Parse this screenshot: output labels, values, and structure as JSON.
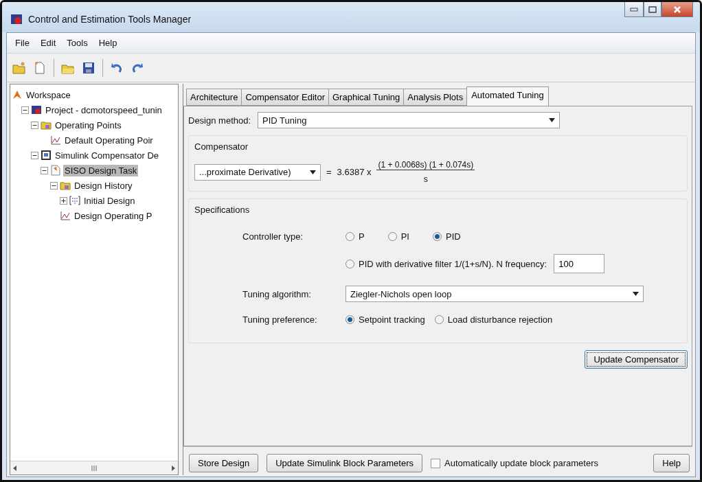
{
  "window": {
    "title": "Control and Estimation Tools Manager"
  },
  "menu": [
    "File",
    "Edit",
    "Tools",
    "Help"
  ],
  "tree": [
    {
      "label": "Workspace",
      "kind": "workspace",
      "selected": false,
      "children": [
        {
          "label": "Project - dcmotorspeed_tunin",
          "kind": "project",
          "expanded": true,
          "selected": false,
          "children": [
            {
              "label": "Operating Points",
              "kind": "folder",
              "expanded": true,
              "selected": false,
              "children": [
                {
                  "label": "Default Operating Poir",
                  "kind": "plot",
                  "selected": false
                }
              ]
            },
            {
              "label": "Simulink Compensator De",
              "kind": "model",
              "expanded": true,
              "selected": false,
              "children": [
                {
                  "label": "SISO Design Task",
                  "kind": "task",
                  "expanded": true,
                  "selected": true,
                  "children": [
                    {
                      "label": "Design History",
                      "kind": "folder",
                      "expanded": true,
                      "selected": false,
                      "children": [
                        {
                          "label": "Initial Design",
                          "kind": "design",
                          "expanded": false,
                          "selected": false
                        }
                      ]
                    },
                    {
                      "label": "Design Operating P",
                      "kind": "plot",
                      "selected": false
                    }
                  ]
                }
              ]
            }
          ]
        }
      ]
    }
  ],
  "tabs": [
    {
      "label": "Architecture",
      "selected": false
    },
    {
      "label": "Compensator Editor",
      "selected": false
    },
    {
      "label": "Graphical Tuning",
      "selected": false
    },
    {
      "label": "Analysis Plots",
      "selected": false
    },
    {
      "label": "Automated Tuning",
      "selected": true
    }
  ],
  "design_method": {
    "label": "Design method:",
    "value": "PID Tuning"
  },
  "compensator": {
    "title": "Compensator",
    "form": "...proximate Derivative)",
    "equals": "=",
    "gain": "3.6387 x",
    "numerator": "(1 + 0.0068s) (1 + 0.074s)",
    "denominator": "s"
  },
  "specifications": {
    "title": "Specifications",
    "controller_type": {
      "label": "Controller type:",
      "options": [
        {
          "label": "P",
          "selected": false
        },
        {
          "label": "PI",
          "selected": false
        },
        {
          "label": "PID",
          "selected": true
        }
      ]
    },
    "filter_option": {
      "label": "PID with derivative filter 1/(1+s/N). N frequency:",
      "selected": false,
      "value": "100"
    },
    "tuning_algorithm": {
      "label": "Tuning algorithm:",
      "value": "Ziegler-Nichols open loop"
    },
    "tuning_preference": {
      "label": "Tuning preference:",
      "options": [
        {
          "label": "Setpoint tracking",
          "selected": true
        },
        {
          "label": "Load disturbance rejection",
          "selected": false
        }
      ]
    }
  },
  "update_button": "Update Compensator",
  "footer": {
    "store": "Store Design",
    "update_simulink": "Update Simulink Block Parameters",
    "auto_update": {
      "label": "Automatically update block parameters",
      "checked": false
    },
    "help": "Help"
  }
}
